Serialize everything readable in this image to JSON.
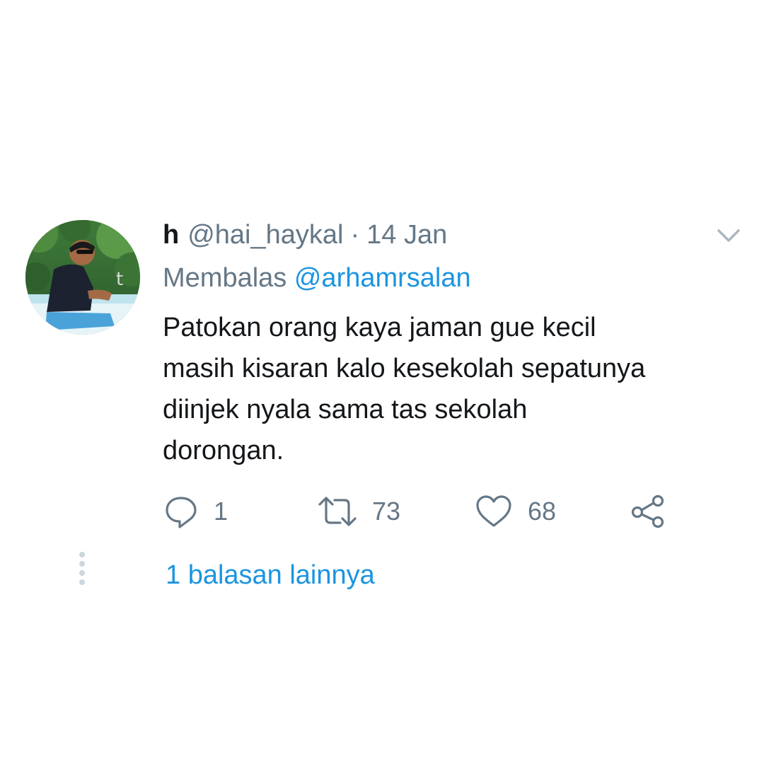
{
  "tweet": {
    "display_name": "h",
    "handle": "@hai_haykal",
    "separator": "·",
    "date": "14 Jan",
    "reply_prefix": "Membalas",
    "reply_mention": "@arhamrsalan",
    "text_lines": [
      "Patokan orang kaya jaman gue kecil",
      "masih kisaran kalo kesekolah sepatunya",
      "diinjek nyala sama tas sekolah",
      "dorongan."
    ],
    "avatar_watermark": "t"
  },
  "actions": {
    "reply_count": "1",
    "retweet_count": "73",
    "like_count": "68"
  },
  "thread": {
    "more_replies_label": "1 balasan lainnya"
  },
  "colors": {
    "text_primary": "#14171a",
    "text_secondary": "#657786",
    "link_blue": "#1b95e0",
    "icon_gray": "#657786",
    "chevron_gray": "#aab8c2",
    "thread_dots": "#ccd6dd"
  },
  "icons": {
    "caret": "chevron-down-icon",
    "reply": "reply-icon",
    "retweet": "retweet-icon",
    "like": "heart-icon",
    "share": "share-icon"
  }
}
